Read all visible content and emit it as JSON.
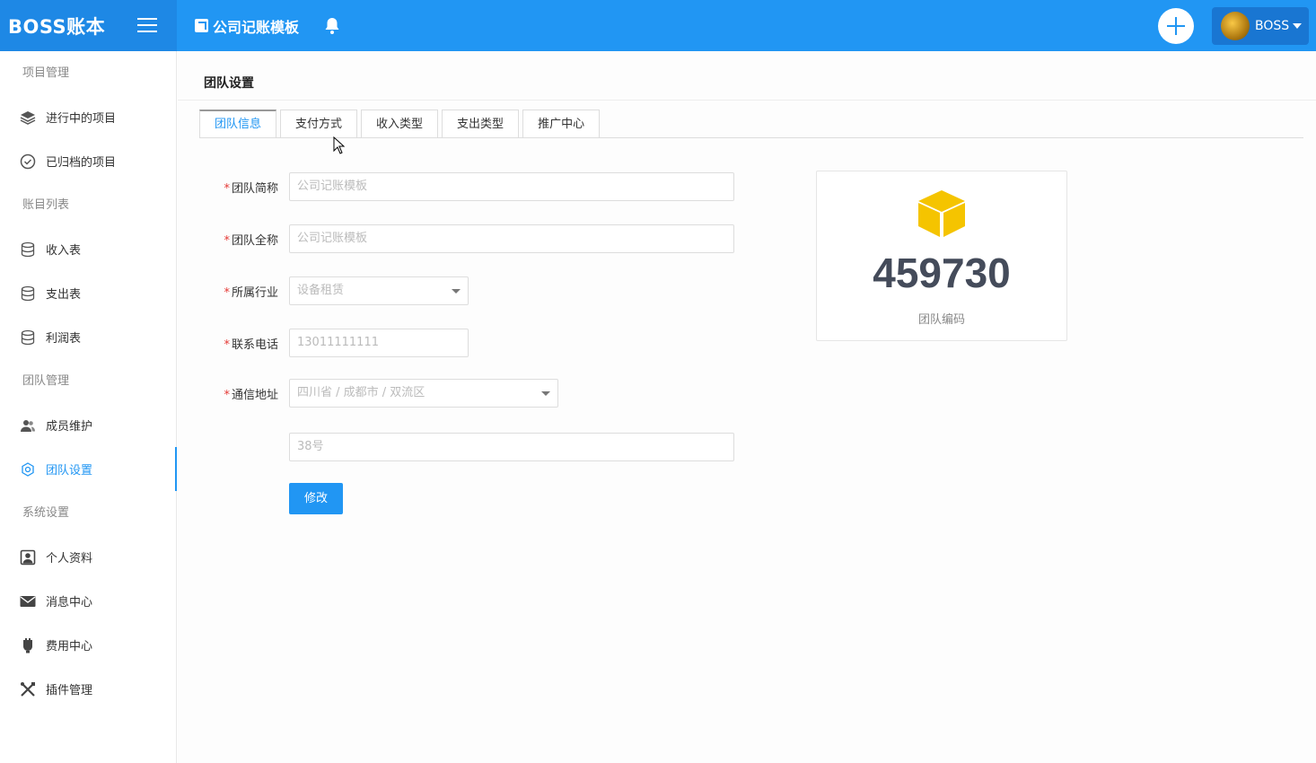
{
  "app": {
    "logo": "BOSS账本"
  },
  "header": {
    "company": "公司记账模板",
    "user_name": "BOSS"
  },
  "sidebar": {
    "groups": [
      {
        "label": "项目管理",
        "items": [
          {
            "label": "进行中的项目",
            "icon": "layers-icon"
          },
          {
            "label": "已归档的项目",
            "icon": "check-circle-icon"
          }
        ]
      },
      {
        "label": "账目列表",
        "items": [
          {
            "label": "收入表",
            "icon": "database-icon"
          },
          {
            "label": "支出表",
            "icon": "database-icon"
          },
          {
            "label": "利润表",
            "icon": "database-icon"
          }
        ]
      },
      {
        "label": "团队管理",
        "items": [
          {
            "label": "成员维护",
            "icon": "users-icon"
          },
          {
            "label": "团队设置",
            "icon": "gear-icon",
            "active": true
          }
        ]
      },
      {
        "label": "系统设置",
        "items": [
          {
            "label": "个人资料",
            "icon": "user-card-icon"
          },
          {
            "label": "消息中心",
            "icon": "envelope-icon"
          },
          {
            "label": "费用中心",
            "icon": "hand-coin-icon"
          },
          {
            "label": "插件管理",
            "icon": "tools-icon"
          }
        ]
      }
    ]
  },
  "main": {
    "title": "团队设置",
    "tabs": [
      "团队信息",
      "支付方式",
      "收入类型",
      "支出类型",
      "推广中心"
    ],
    "active_tab": "团队信息",
    "form": {
      "short_name": {
        "label": "团队简称",
        "value": "公司记账模板"
      },
      "full_name": {
        "label": "团队全称",
        "value": "公司记账模板"
      },
      "industry": {
        "label": "所属行业",
        "value": "设备租赁"
      },
      "phone": {
        "label": "联系电话",
        "value": "13011111111"
      },
      "address": {
        "label": "通信地址",
        "value": "四川省 / 成都市 / 双流区",
        "detail": "38号"
      },
      "required_mark": "*",
      "submit_label": "修改"
    },
    "team_card": {
      "code": "459730",
      "label": "团队编码",
      "icon": "cube-icon",
      "icon_color": "#f5c400"
    }
  },
  "colors": {
    "primary": "#2196f3",
    "header_logo_bg": "#1e88e5",
    "required": "#e53935"
  }
}
